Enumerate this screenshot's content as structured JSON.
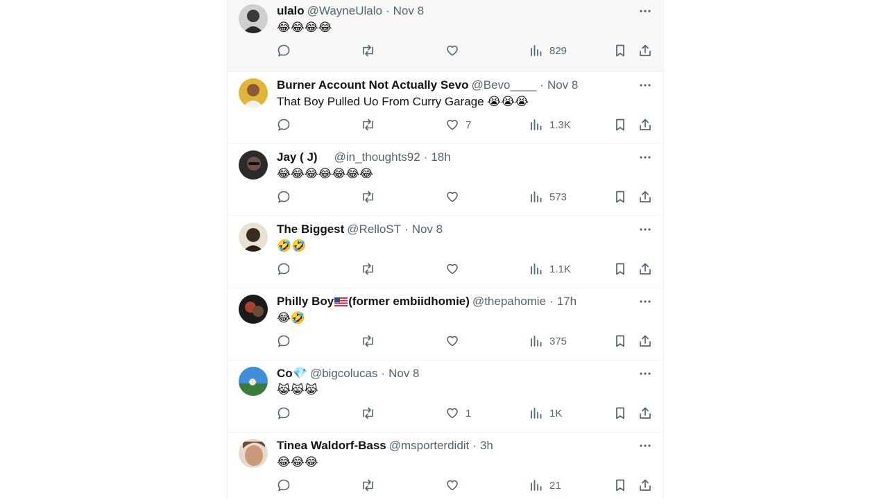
{
  "colors": {
    "icon": "#536471",
    "text": "#0f1419",
    "border": "#eff3f4",
    "highlight_bg": "#f7f7f7"
  },
  "tweets": [
    {
      "name": "ulalo",
      "handle": "@WayneUlalo",
      "time": "Nov 8",
      "text": "😂😂😂😂",
      "replies": "",
      "retweets": "",
      "likes": "",
      "views": "829",
      "avatar_colors": [
        "#3a3a3a",
        "#d9d9d9"
      ]
    },
    {
      "name": "Burner Account Not Actually Sevo",
      "handle": "@Bevo____",
      "time": "Nov 8",
      "text": "That Boy Pulled Uo From Curry Garage 😭😭😭",
      "replies": "",
      "retweets": "",
      "likes": "7",
      "views": "1.3K",
      "avatar_colors": [
        "#e2b43a",
        "#6b4a2e"
      ]
    },
    {
      "name": "Jay ( J)",
      "handle": "@in_thoughts92",
      "time": "18h",
      "text": "😂😂😂😂😂😂😂",
      "replies": "",
      "retweets": "",
      "likes": "",
      "views": "573",
      "avatar_colors": [
        "#2b2b2b",
        "#5a4a42"
      ]
    },
    {
      "name": "The Biggest",
      "handle": "@RelloST",
      "time": "Nov 8",
      "text": "🤣🤣",
      "replies": "",
      "retweets": "",
      "likes": "",
      "views": "1.1K",
      "avatar_colors": [
        "#e8e2d2",
        "#3b2a1e"
      ]
    },
    {
      "name": "Philly Boy",
      "name_suffix": "(former embiidhomie)",
      "handle": "@thepahomie",
      "time": "17h",
      "text": "😂🤣",
      "replies": "",
      "retweets": "",
      "likes": "",
      "views": "375",
      "avatar_colors": [
        "#1e1a1a",
        "#a8402e"
      ]
    },
    {
      "name": "Co💎",
      "handle": "@bigcolucas",
      "time": "Nov 8",
      "text": "😹😹😹",
      "replies": "",
      "retweets": "",
      "likes": "1",
      "views": "1K",
      "avatar_colors": [
        "#3f8fd8",
        "#3a7d3a"
      ]
    },
    {
      "name": "Tinea Waldorf-Bass",
      "handle": "@msporterdidit",
      "time": "3h",
      "text": "😂😂😂",
      "replies": "",
      "retweets": "",
      "likes": "",
      "views": "21",
      "avatar_colors": [
        "#c89a7a",
        "#6b4a3a"
      ]
    }
  ]
}
